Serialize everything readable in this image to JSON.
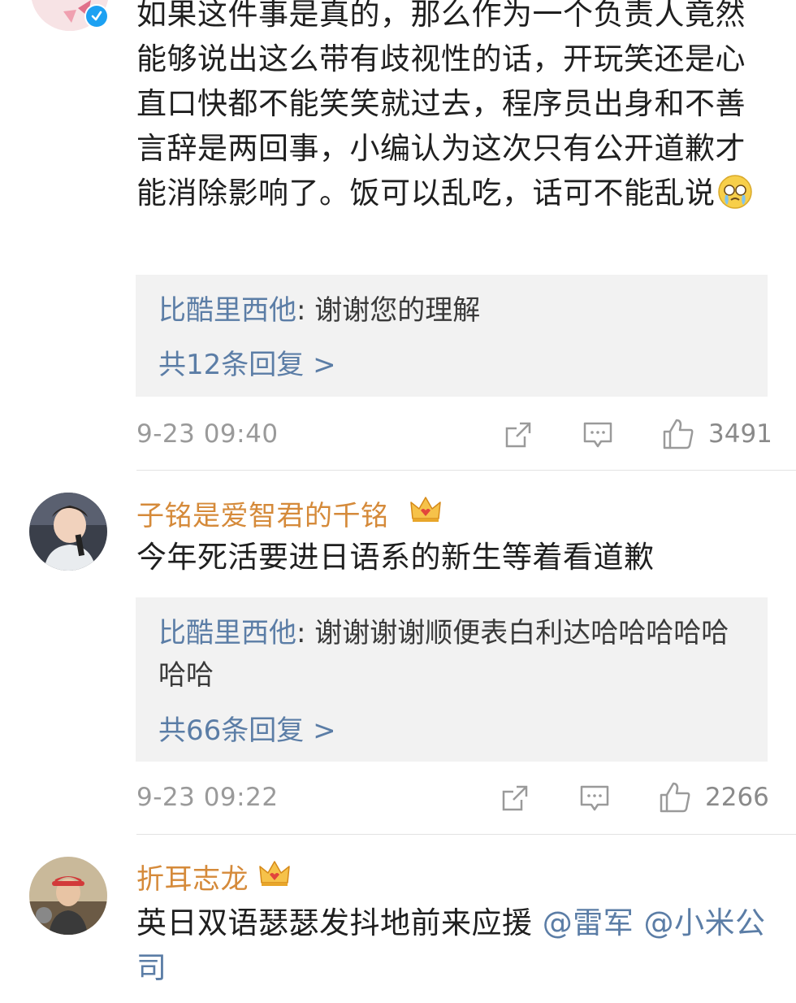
{
  "comment1": {
    "body": "如果这件事是真的，那么作为一个负责人竟然能够说出这么带有歧视性的话，开玩笑还是心直口快都不能笑笑就过去，程序员出身和不善言辞是两回事，小编认为这次只有公开道歉才能消除影响了。饭可以乱吃，话可不能乱说",
    "emoji": "crying-face-emoji",
    "reply": {
      "name": "比酷里西他",
      "text": ": 谢谢您的理解",
      "count": "共12条回复 >"
    },
    "time": "9-23 09:40",
    "likes": "3491"
  },
  "comment2": {
    "username": "子铭是爱智君的千铭",
    "body": "今年死活要进日语系的新生等着看道歉",
    "reply": {
      "name": "比酷里西他",
      "text": ": 谢谢谢谢顺便表白利达哈哈哈哈哈哈哈",
      "count": "共66条回复 >"
    },
    "time": "9-23 09:22",
    "likes": "2266"
  },
  "comment3": {
    "username": "折耳志龙",
    "body": "英日双语瑟瑟发抖地前来应援 ",
    "mention1": "@雷军",
    "mention2": "@小米公司"
  },
  "colors": {
    "username": "#d58a3a",
    "link": "#5b7da6",
    "reply_bg": "#f2f2f2",
    "verified": "#1da1f2"
  }
}
